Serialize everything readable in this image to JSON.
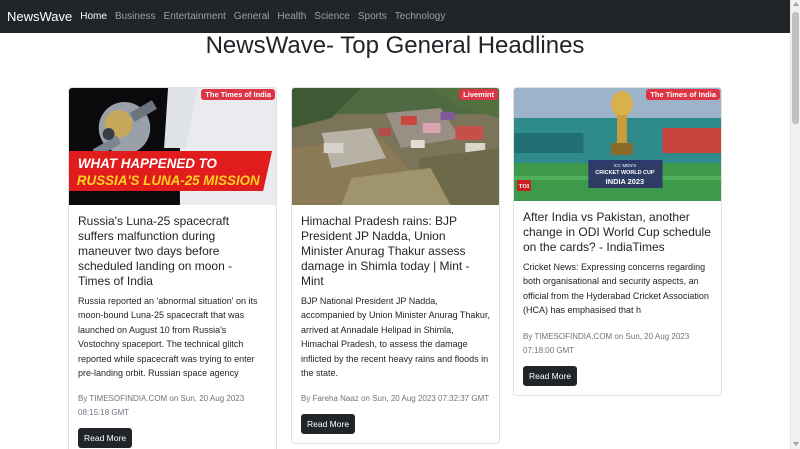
{
  "nav": {
    "brand": "NewsWave",
    "links": [
      "Home",
      "Business",
      "Entertainment",
      "General",
      "Health",
      "Science",
      "Sports",
      "Technology"
    ]
  },
  "page": {
    "title": "NewsWave- Top General Headlines"
  },
  "colors": {
    "navbar_bg": "#212529",
    "badge_bg": "#dc3545",
    "button_bg": "#212529"
  },
  "articles": [
    {
      "source": "The Times of India",
      "image_caption_line1": "WHAT HAPPENED TO",
      "image_caption_line2": "RUSSIA'S LUNA-25 MISSION",
      "title": "Russia's Luna-25 spacecraft suffers malfunction during maneuver two days before scheduled landing on moon - Times of India",
      "description": "Russia reported an 'abnormal situation' on its moon-bound Luna-25 spacecraft that was launched on August 10 from Russia's Vostochny spaceport. The technical glitch reported while spacecraft was trying to enter pre-landing orbit. Russian space agency",
      "author": "TIMESOFINDIA.COM",
      "date": "Sun, 20 Aug 2023 08:15:18 GMT",
      "button": "Read More"
    },
    {
      "source": "Livemint",
      "title": "Himachal Pradesh rains: BJP President JP Nadda, Union Minister Anurag Thakur assess damage in Shimla today | Mint - Mint",
      "description": "BJP National President JP Nadda, accompanied by Union Minister Anurag Thakur, arrived at Annadale Helipad in Shimla, Himachal Pradesh, to assess the damage inflicted by the recent heavy rains and floods in the state.",
      "author": "Fareha Naaz",
      "date": "Sun, 20 Aug 2023 07:32:37 GMT",
      "button": "Read More"
    },
    {
      "source": "The Times of India",
      "image_logo": "TOI",
      "image_caption_line1": "ICC MEN'S",
      "image_caption_line2": "CRICKET WORLD CUP",
      "image_caption_line3": "INDIA 2023",
      "title": "After India vs Pakistan, another change in ODI World Cup schedule on the cards? - IndiaTimes",
      "description": "Cricket News: Expressing concerns regarding both organisational and security aspects, an official from the Hyderabad Cricket Association (HCA) has emphasised that h",
      "author": "TIMESOFINDIA.COM",
      "date": "Sun, 20 Aug 2023 07:18:00 GMT",
      "button": "Read More"
    }
  ]
}
